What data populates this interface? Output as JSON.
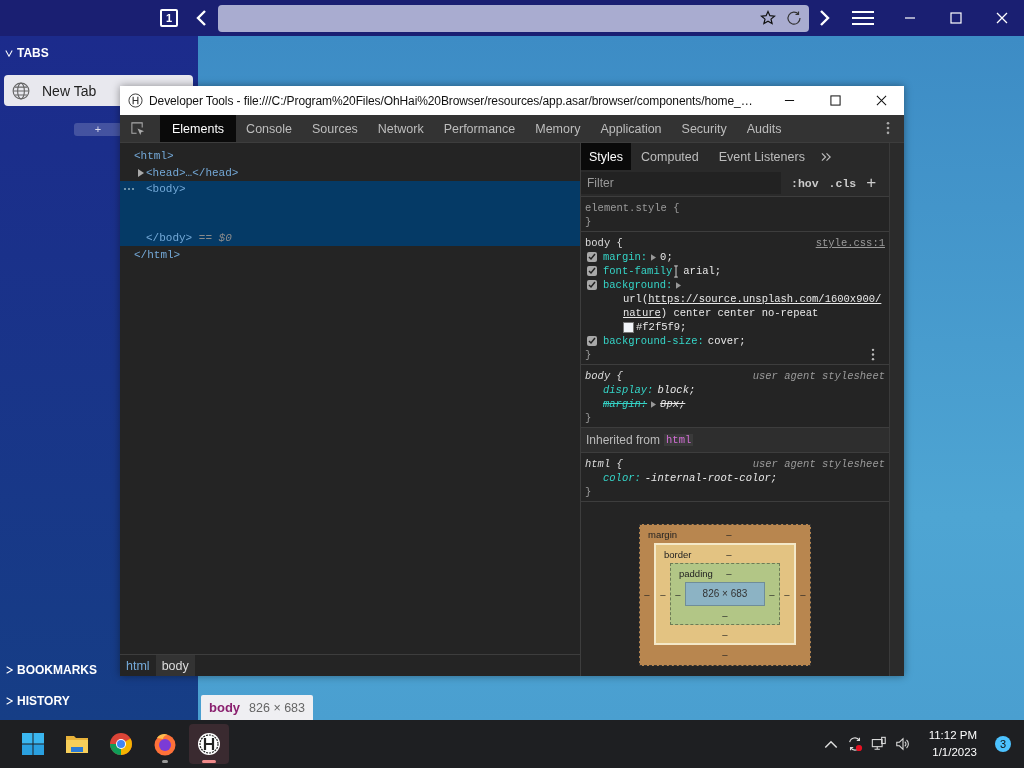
{
  "browser": {
    "tab_count": "1",
    "sidebar": {
      "sections": [
        {
          "label": "TABS",
          "expanded": true
        },
        {
          "label": "BOOKMARKS",
          "expanded": false
        },
        {
          "label": "HISTORY",
          "expanded": false
        }
      ],
      "tabs": [
        {
          "title": "New Tab",
          "selected": true
        }
      ],
      "new_tab_button": "+"
    }
  },
  "devtools": {
    "title": "Developer Tools - file:///C:/Program%20Files/OhHai%20Browser/resources/app.asar/browser/components/home_…",
    "tabs": [
      {
        "label": "Elements",
        "selected": true
      },
      {
        "label": "Console",
        "selected": false
      },
      {
        "label": "Sources",
        "selected": false
      },
      {
        "label": "Network",
        "selected": false
      },
      {
        "label": "Performance",
        "selected": false
      },
      {
        "label": "Memory",
        "selected": false
      },
      {
        "label": "Application",
        "selected": false
      },
      {
        "label": "Security",
        "selected": false
      },
      {
        "label": "Audits",
        "selected": false
      }
    ],
    "dom": [
      {
        "open": "<html>",
        "close": "</html>",
        "expanded": true,
        "selected": false,
        "children": [
          {
            "open": "<head>…</head>",
            "expanded": false,
            "selected": false
          },
          {
            "open": "<body>",
            "close": "</body>",
            "marker": "== $0",
            "expanded": true,
            "selected": true
          }
        ]
      }
    ],
    "breadcrumbs": [
      {
        "label": "html",
        "selected": false
      },
      {
        "label": "body",
        "selected": true
      }
    ],
    "side_tabs": [
      {
        "label": "Styles",
        "selected": true
      },
      {
        "label": "Computed",
        "selected": false
      },
      {
        "label": "Event Listeners",
        "selected": false
      }
    ],
    "filter": {
      "placeholder": "Filter"
    },
    "hov": ":hov",
    "cls": ".cls",
    "add": "+",
    "rules": [
      {
        "kind": "inline",
        "selector": "element.style {",
        "close": "}"
      },
      {
        "kind": "author",
        "selector": "body {",
        "source": "style.css:1",
        "close": "}",
        "menu": true,
        "props": [
          {
            "name": "margin:",
            "value": "0;",
            "checked": true,
            "expandable": true
          },
          {
            "name": "font-family",
            "value": "arial;",
            "checked": true,
            "cursor": true
          },
          {
            "name": "background:",
            "checked": true,
            "expandable": true,
            "lines": [
              [
                {
                  "text": "url("
                },
                {
                  "text": "https://source.unsplash.com/1600x900/",
                  "link": true
                }
              ],
              [
                {
                  "text": "nature",
                  "link": true
                },
                {
                  "text": ") center center no-repeat"
                }
              ],
              [
                {
                  "color": "#f2f5f9",
                  "text": "#f2f5f9;"
                }
              ]
            ]
          },
          {
            "name": "background-size:",
            "value": "cover;",
            "checked": true
          }
        ]
      },
      {
        "kind": "user-agent",
        "selector": "body {",
        "source": "user agent stylesheet",
        "close": "}",
        "props": [
          {
            "name": "display:",
            "value": "block;"
          },
          {
            "name": "margin:",
            "value": "8px;",
            "expandable": true,
            "overridden": true
          }
        ]
      },
      {
        "kind": "inherited",
        "label": "Inherited from",
        "tag": "html"
      },
      {
        "kind": "user-agent",
        "selector": "html {",
        "source": "user agent stylesheet",
        "close": "}",
        "props": [
          {
            "name": "color:",
            "value": "-internal-root-color;"
          }
        ]
      }
    ],
    "box_model": {
      "margin": {
        "label": "margin",
        "top": "–",
        "right": "–",
        "bottom": "–",
        "left": "–"
      },
      "border": {
        "label": "border",
        "top": "–",
        "right": "–",
        "bottom": "–",
        "left": "–"
      },
      "padding": {
        "label": "padding",
        "top": "–",
        "right": "–",
        "bottom": "–",
        "left": "–"
      },
      "content": "826 × 683"
    }
  },
  "tooltip": {
    "tag": "body",
    "size": "826 × 683"
  },
  "taskbar": {
    "apps": [
      {
        "kind": "windows",
        "active": false,
        "running": false
      },
      {
        "kind": "folder",
        "active": false,
        "running": false
      },
      {
        "kind": "chrome",
        "active": false,
        "running": false
      },
      {
        "kind": "firefox",
        "active": false,
        "running": true
      },
      {
        "kind": "ohhai",
        "active": true,
        "running": true
      }
    ],
    "time": "11:12 PM",
    "date": "1/1/2023",
    "notifications": "3"
  }
}
